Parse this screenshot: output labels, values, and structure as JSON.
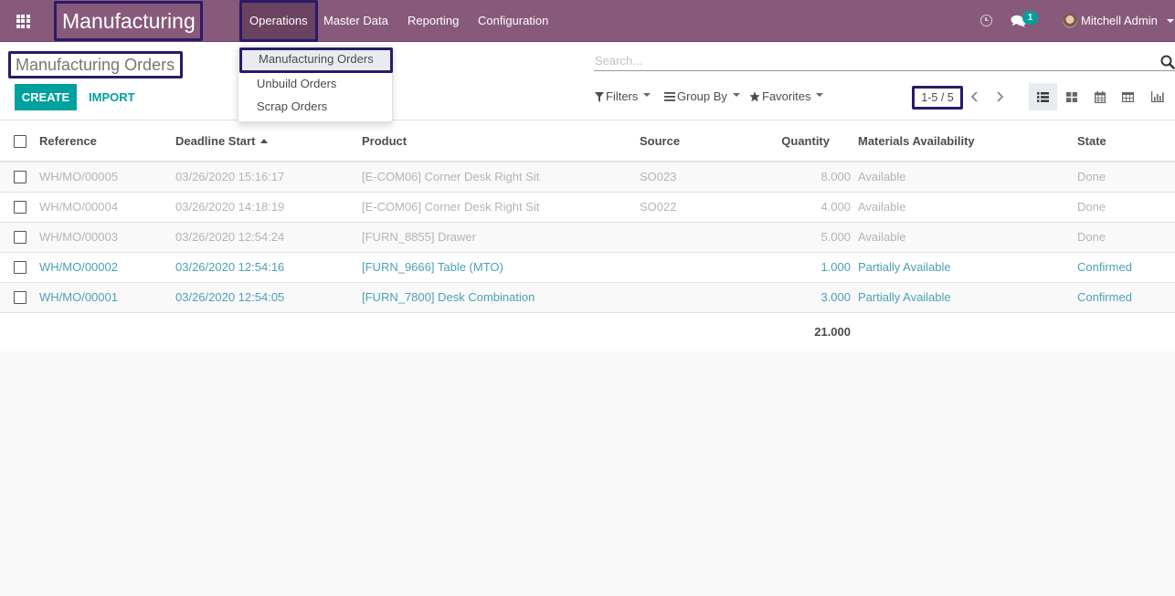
{
  "navbar": {
    "app_name": "Manufacturing",
    "menus": [
      "Operations",
      "Master Data",
      "Reporting",
      "Configuration"
    ],
    "active_menu": "Operations",
    "chat_badge": "1",
    "user_name": "Mitchell Admin",
    "icons": {
      "apps": "apps-grid-icon",
      "activity": "clock-icon",
      "messages": "chat-icon",
      "user": "avatar"
    }
  },
  "dropdown": {
    "items": [
      "Manufacturing Orders",
      "Unbuild Orders",
      "Scrap Orders"
    ],
    "active_item": "Manufacturing Orders"
  },
  "control_panel": {
    "breadcrumb": "Manufacturing Orders",
    "create_label": "CREATE",
    "import_label": "IMPORT",
    "search_placeholder": "Search...",
    "search_value": "",
    "filters_label": "Filters",
    "group_by_label": "Group By",
    "favorites_label": "Favorites",
    "pager": "1-5 / 5",
    "views": [
      "list",
      "kanban",
      "calendar",
      "pivot",
      "graph"
    ],
    "active_view": "list"
  },
  "table": {
    "columns": [
      "Reference",
      "Deadline Start",
      "Product",
      "Source",
      "Quantity",
      "Materials Availability",
      "State"
    ],
    "sorted_column": "Deadline Start",
    "sort_direction": "asc",
    "rows": [
      {
        "reference": "WH/MO/00005",
        "deadline": "03/26/2020 15:16:17",
        "product": "[E-COM06] Corner Desk Right Sit",
        "source": "SO023",
        "quantity": "8.000",
        "availability": "Available",
        "state": "Done"
      },
      {
        "reference": "WH/MO/00004",
        "deadline": "03/26/2020 14:18:19",
        "product": "[E-COM06] Corner Desk Right Sit",
        "source": "SO022",
        "quantity": "4.000",
        "availability": "Available",
        "state": "Done"
      },
      {
        "reference": "WH/MO/00003",
        "deadline": "03/26/2020 12:54:24",
        "product": "[FURN_8855] Drawer",
        "source": "",
        "quantity": "5.000",
        "availability": "Available",
        "state": "Done"
      },
      {
        "reference": "WH/MO/00002",
        "deadline": "03/26/2020 12:54:16",
        "product": "[FURN_9666] Table (MTO)",
        "source": "",
        "quantity": "1.000",
        "availability": "Partially Available",
        "state": "Confirmed"
      },
      {
        "reference": "WH/MO/00001",
        "deadline": "03/26/2020 12:54:05",
        "product": "[FURN_7800] Desk Combination",
        "source": "",
        "quantity": "3.000",
        "availability": "Partially Available",
        "state": "Confirmed"
      }
    ],
    "total_quantity": "21.000"
  },
  "colors": {
    "navbar": "#875a7b",
    "primary": "#00a09d",
    "done_text": "#adb5bd",
    "confirmed_text": "#4ba0b5",
    "highlight_border": "#2b1a66"
  }
}
